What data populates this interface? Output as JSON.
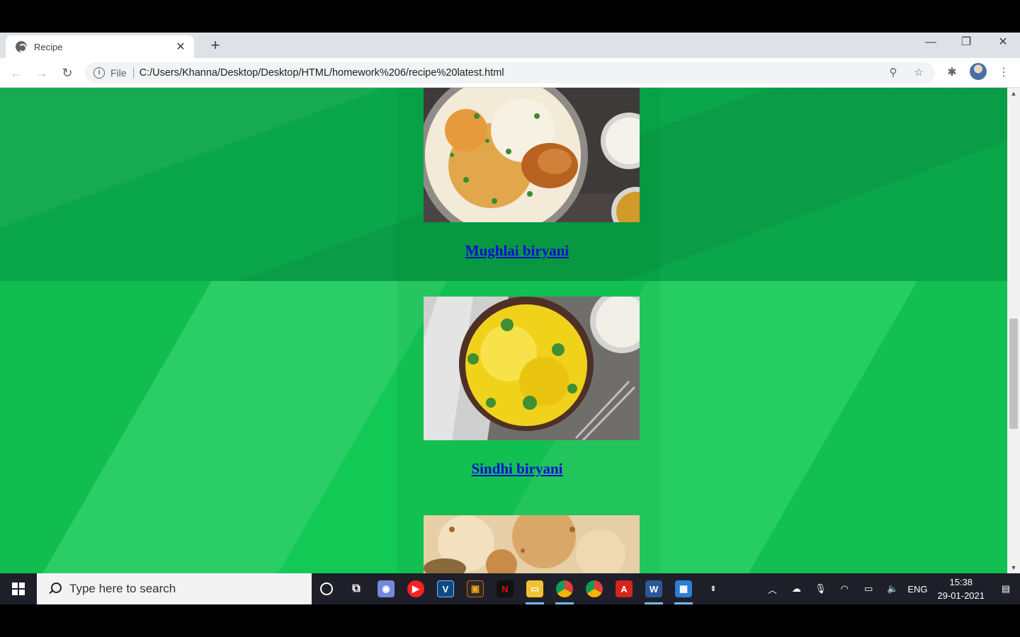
{
  "browser": {
    "tab_title": "Recipe",
    "tab_close": "✕",
    "new_tab": "+",
    "window_controls": {
      "minimize": "—",
      "restore": "❐",
      "close": "✕"
    },
    "scheme_label": "File",
    "url": "C:/Users/Khanna/Desktop/Desktop/HTML/homework%206/recipe%20latest.html"
  },
  "page": {
    "recipes": [
      {
        "title": "Mughlai biryani",
        "image_icon": "chicken-biryani-photo"
      },
      {
        "title": "Sindhi biryani",
        "image_icon": "yellow-rice-biryani-photo"
      },
      {
        "title": "",
        "image_icon": "biryani-photo-partial"
      }
    ],
    "colors": {
      "background": "#12b04a",
      "link": "#0b0bd8"
    }
  },
  "taskbar": {
    "search_placeholder": "Type here to search",
    "language": "ENG",
    "time": "15:38",
    "date": "29-01-2021"
  }
}
